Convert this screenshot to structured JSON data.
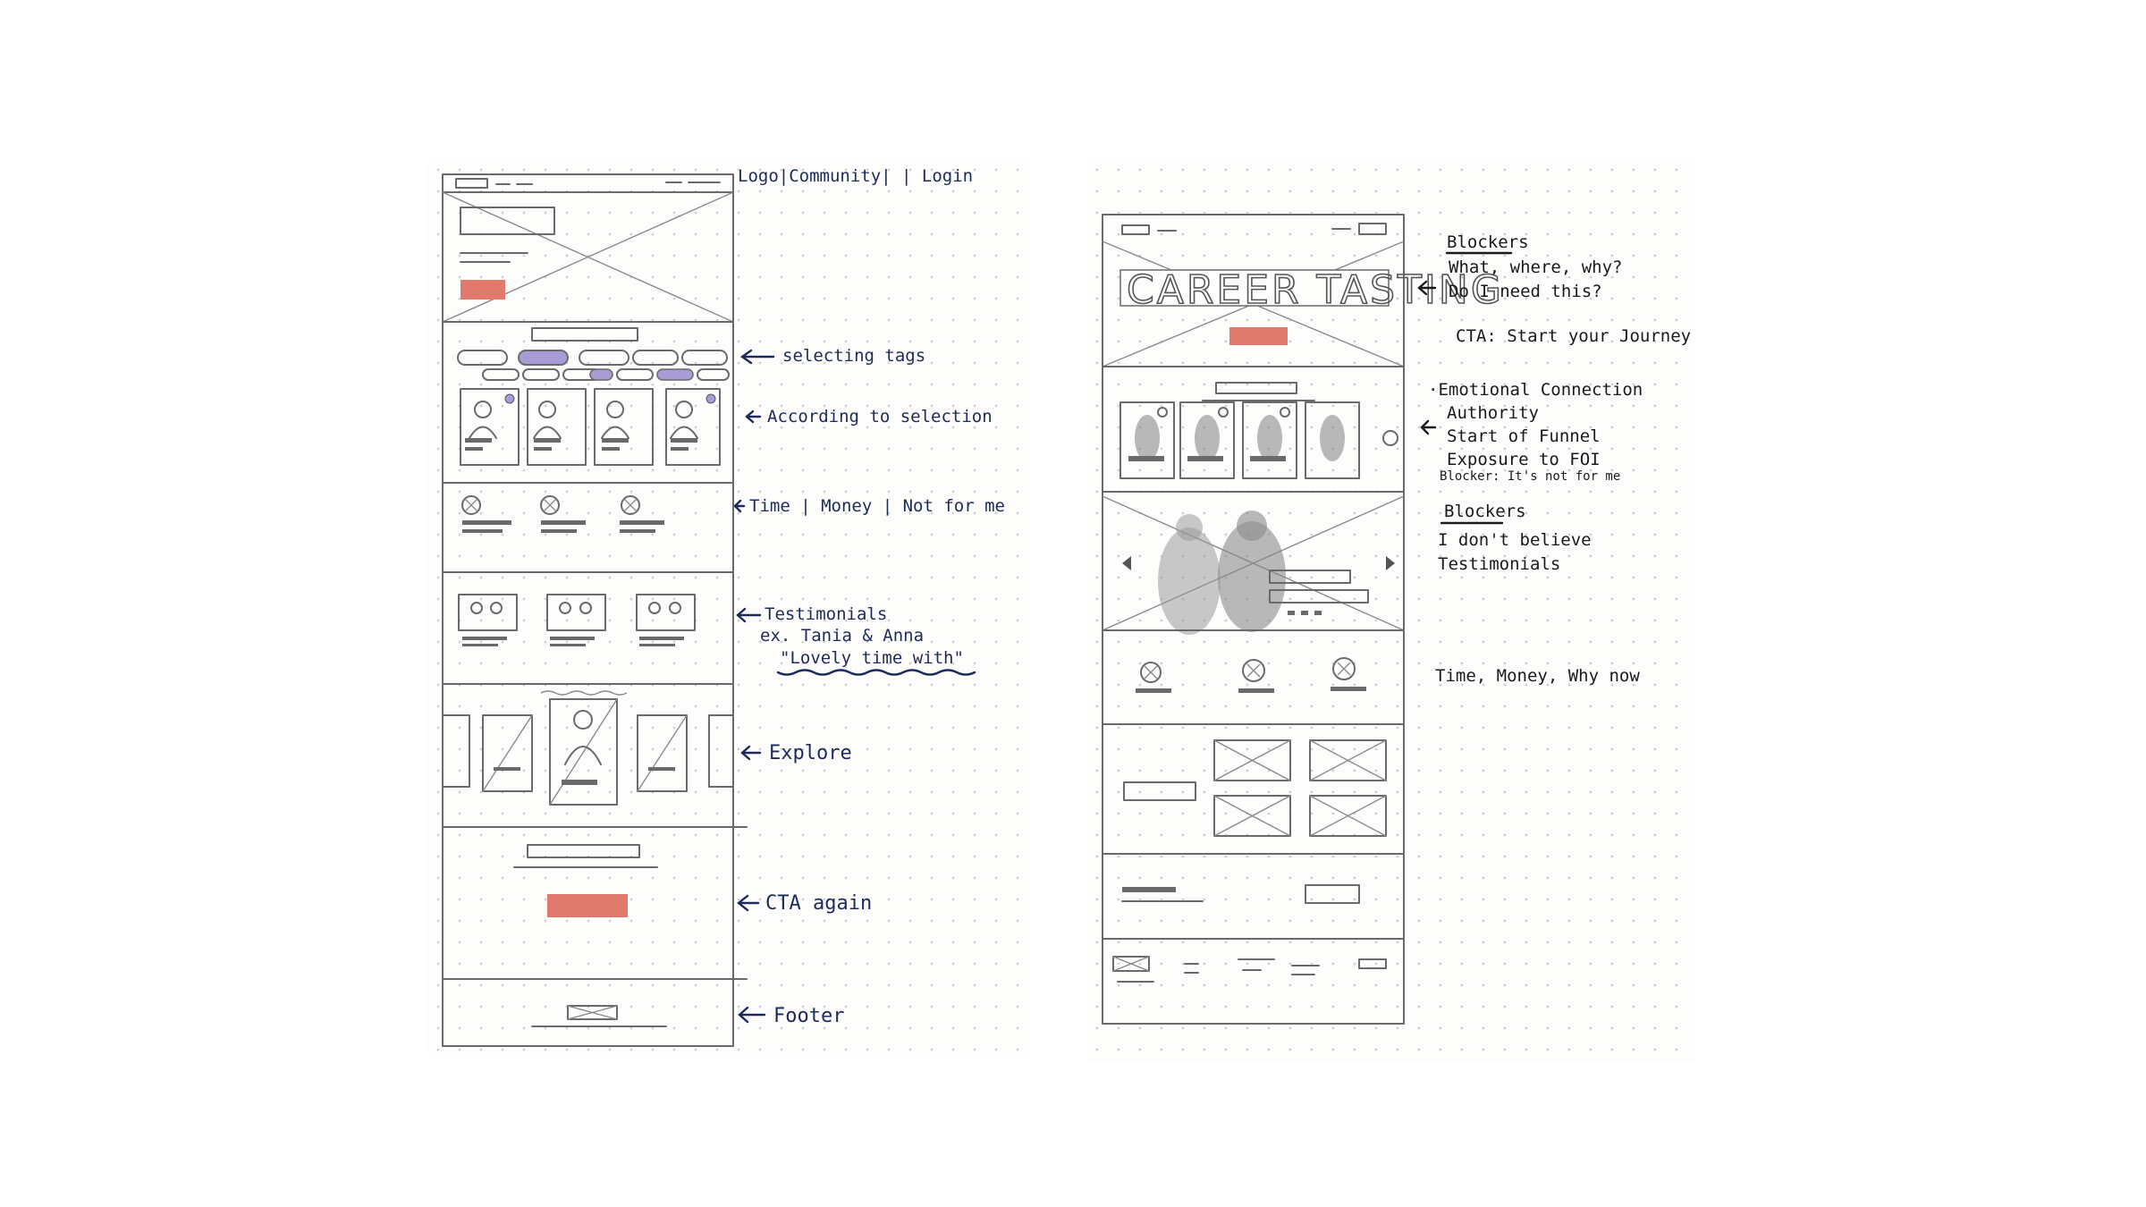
{
  "colors": {
    "cta_red": "#e07a6c",
    "tag_purple": "#a99bd6",
    "ink_blue": "#1d2a5c",
    "pencil": "#6a6a6a"
  },
  "left_sketch": {
    "nav_note": "Logo|Community|   |   Login",
    "annotations": {
      "selecting_tags": "selecting tags",
      "according_to_selection": "According to selection",
      "time_money_not_for_me": "Time  | Money  | Not for me",
      "testimonials": "Testimonials",
      "testimonials_example": "ex. Tania & Anna",
      "testimonials_quote": "\"Lovely time with\"",
      "explore": "Explore",
      "cta_again": "CTA again",
      "footer": "Footer"
    }
  },
  "right_sketch": {
    "hero_title": "CAREER TASTING",
    "annotations": {
      "blockers_heading": "Blockers",
      "blockers_line1": "What, where, why?",
      "blockers_line2": "Do I need this?",
      "cta": "CTA: Start your Journey",
      "emotional": "·Emotional Connection",
      "authority": "Authority",
      "start_funnel": "Start of Funnel",
      "exposure": "Exposure to FOI",
      "blocker_not_for_me": "Blocker: It's not for me",
      "blockers2_heading": "Blockers",
      "dont_believe": "I don't believe",
      "testimonials": "Testimonials",
      "time_money_why_now": "Time, Money, Why now"
    }
  }
}
